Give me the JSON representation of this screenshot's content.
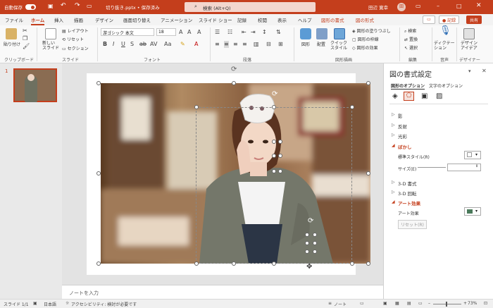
{
  "titlebar": {
    "autosave_label": "自動保存",
    "autosave_state": "オン",
    "filename": "切り抜き.pptx • 保存済み",
    "search_placeholder": "検索 (Alt+Q)",
    "user_name": "田辺 寛幸",
    "user_initials": "田"
  },
  "tabs": {
    "items": [
      "ファイル",
      "ホーム",
      "挿入",
      "描画",
      "デザイン",
      "画面切り替え",
      "アニメーション",
      "スライド ショー",
      "記録",
      "校閲",
      "表示",
      "ヘルプ",
      "図形の書式",
      "図の形式"
    ],
    "active_index": 1,
    "record_label": "記録",
    "share_label": "共有"
  },
  "ribbon": {
    "clipboard": {
      "paste": "貼り付け",
      "label": "クリップボード"
    },
    "slides": {
      "new_slide": "新しい\nスライド",
      "layout": "レイアウト",
      "reset": "リセット",
      "section": "セクション",
      "label": "スライド"
    },
    "font": {
      "name": "游ゴシック 本文",
      "size": "18",
      "label": "フォント"
    },
    "paragraph": {
      "label": "段落"
    },
    "drawing": {
      "shape": "図形",
      "arrange": "配置",
      "quick_styles": "クイック\nスタイル",
      "fill": "図形の塗りつぶし",
      "outline": "図形の枠線",
      "effects": "図形の効果",
      "label": "図形描画"
    },
    "editing": {
      "find": "検索",
      "replace": "置換",
      "select": "選択",
      "label": "編集"
    },
    "voice": {
      "dictate": "ディクテー\nション",
      "label": "音声"
    },
    "designer": {
      "design_ideas": "デザイン\nアイデア",
      "label": "デザイナー"
    }
  },
  "slide_panel": {
    "slide_number": "1"
  },
  "notes": {
    "placeholder": "ノートを入力"
  },
  "pane": {
    "title": "図の書式設定",
    "tab_shape_options": "図形のオプション",
    "tab_text_options": "文字のオプション",
    "sections": [
      "影",
      "反射",
      "光彩",
      "ぼかし",
      "3-D 書式",
      "3-D 回転",
      "アート効果"
    ],
    "blur_preset_label": "標準スタイル(R)",
    "blur_size_label": "サイズ(E)",
    "art_effects_label": "アート効果",
    "reset_label": "リセット(R)"
  },
  "status": {
    "slide_info": "スライド 1/1",
    "language": "日本語",
    "accessibility": "アクセシビリティ: 検討が必要です",
    "notes_button": "ノート",
    "zoom": "73%"
  },
  "colors": {
    "accent": "#c43e1c",
    "titlebar": "#c43e1c"
  }
}
